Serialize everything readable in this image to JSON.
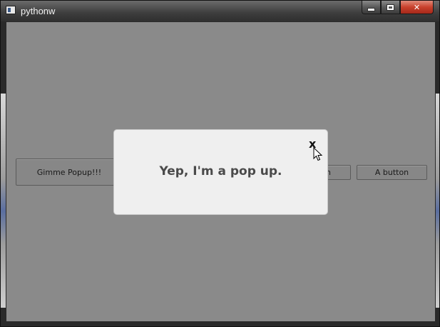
{
  "window": {
    "title": "pythonw",
    "controls": {
      "minimize_icon": "minimize-icon",
      "maximize_icon": "maximize-icon",
      "close_glyph": "✕"
    }
  },
  "buttons": {
    "gimme_popup": "Gimme Popup!!!",
    "partial_hidden": "n",
    "a_button": "A button"
  },
  "popup": {
    "message": "Yep, I'm a pop up.",
    "close_label": "x"
  },
  "colors": {
    "client_background": "#8a8a8a",
    "popup_background": "#efefef",
    "close_button": "#c9412c"
  }
}
